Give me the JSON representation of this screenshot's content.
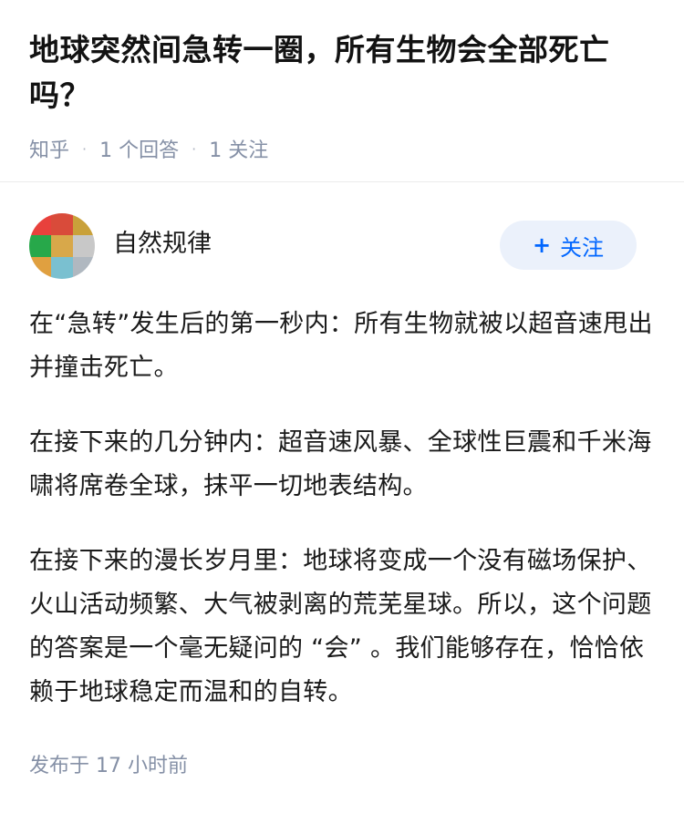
{
  "question": {
    "title": "地球突然间急转一圈，所有生物会全部死亡吗？",
    "source": "知乎",
    "answer_count": "1 个回答",
    "follow_count": "1 关注"
  },
  "answer": {
    "author": {
      "name": "自然规律",
      "avatar_colors": [
        "#e8413c",
        "#d94b3a",
        "#c9a13a",
        "#27a84a",
        "#d8a84a",
        "#c8c8c8",
        "#e0a040",
        "#7ac0d0",
        "#b0b8c0"
      ]
    },
    "follow_button": {
      "plus": "+",
      "label": "关注"
    },
    "paragraphs": [
      "在“急转”发生后的第一秒内：所有生物就被以超音速甩出并撞击死亡。",
      "在接下来的几分钟内：超音速风暴、全球性巨震和千米海啸将席卷全球，抹平一切地表结构。",
      "在接下来的漫长岁月里：地球将变成一个没有磁场保护、火山活动频繁、大气被剥离的荒芜星球。所以，这个问题的答案是一个毫无疑问的 “会” 。我们能够存在，恰恰依赖于地球稳定而温和的自转。"
    ],
    "publish_time": "发布于 17 小时前"
  },
  "colors": {
    "accent": "#0066ff",
    "follow_bg": "#ebf1fb",
    "meta": "#8590a6"
  }
}
